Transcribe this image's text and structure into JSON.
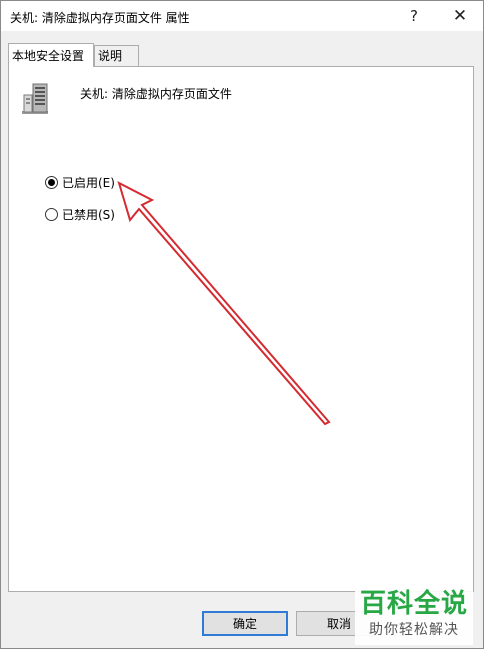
{
  "window": {
    "title": "关机: 清除虚拟内存页面文件 属性",
    "help_glyph": "?",
    "close_glyph": "✕"
  },
  "tabs": [
    {
      "label": "本地安全设置",
      "active": true
    },
    {
      "label": "说明",
      "active": false
    }
  ],
  "policy": {
    "icon": "server-policy-icon",
    "name": "关机: 清除虚拟内存页面文件"
  },
  "options": [
    {
      "label": "已启用(E)",
      "selected": true
    },
    {
      "label": "已禁用(S)",
      "selected": false
    }
  ],
  "buttons": {
    "ok_label": "确定",
    "cancel_label": "取消"
  },
  "annotation": {
    "type": "arrow",
    "color": "#d42a30"
  },
  "watermark": {
    "title": "百科全说",
    "subtitle": "助你轻松解决",
    "color": "#28a745"
  }
}
